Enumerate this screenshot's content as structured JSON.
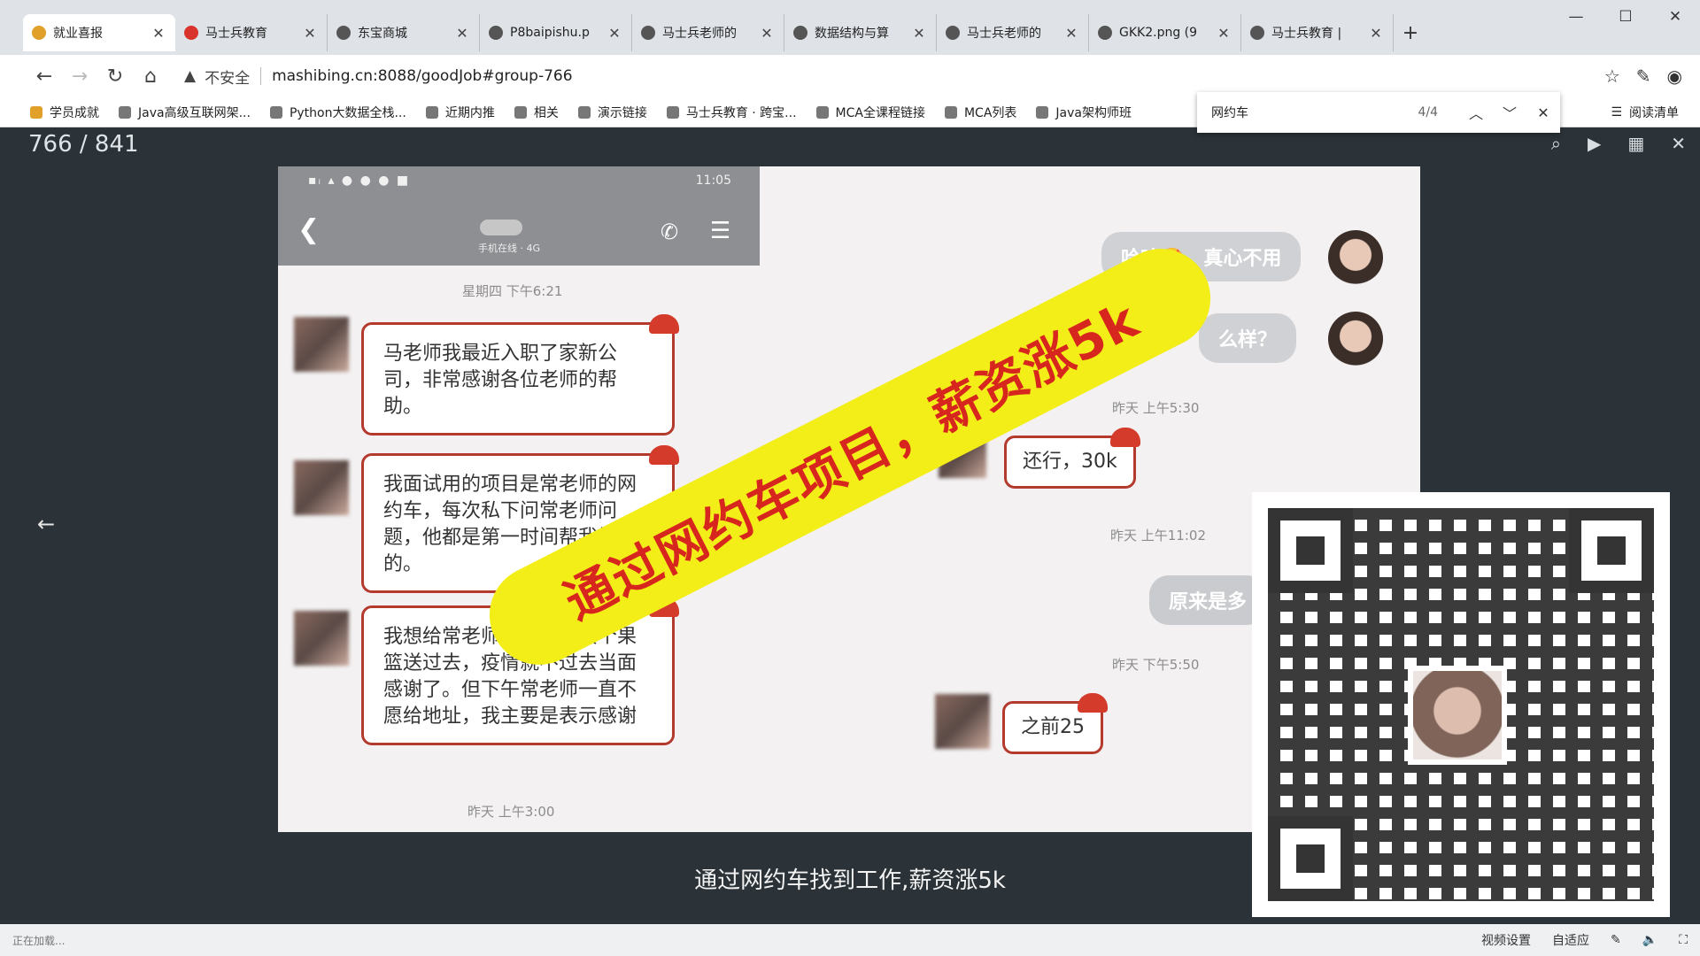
{
  "tabs": [
    {
      "label": "就业喜报",
      "color": "#e0a02a"
    },
    {
      "label": "马士兵教育",
      "color": "#d9342b"
    },
    {
      "label": "东宝商城",
      "color": "#555555"
    },
    {
      "label": "P8baipishu.p",
      "color": "#555555"
    },
    {
      "label": "马士兵老师的",
      "color": "#555555"
    },
    {
      "label": "数据结构与算",
      "color": "#555555"
    },
    {
      "label": "马士兵老师的",
      "color": "#555555"
    },
    {
      "label": "GKK2.png (9",
      "color": "#555555"
    },
    {
      "label": "马士兵教育 |",
      "color": "#555555"
    }
  ],
  "address": {
    "insecure_label": "不安全",
    "url": "mashibing.cn:8088/goodJob#group-766"
  },
  "bookmarks": [
    "学员成就",
    "Java高级互联网架...",
    "Python大数据全栈...",
    "近期内推",
    "相关",
    "演示链接",
    "马士兵教育 · 跨宝...",
    "MCA全课程链接",
    "MCA列表",
    "Java架构师班"
  ],
  "reading_list": "阅读清单",
  "find": {
    "query": "网约车",
    "count": "4/4"
  },
  "viewer": {
    "page": "766 / 841"
  },
  "phone": {
    "status_time": "11:05",
    "contact_sub": "手机在线 · 4G"
  },
  "chat": {
    "ts1": "星期四 下午6:21",
    "left_msgs": [
      "马老师我最近入职了家新公司，非常感谢各位老师的帮助。",
      "我面试用的项目是常老师的网约车，每次私下问常老师问题，他都是第一时间帮我解决的。",
      "我想给常老师和马老师买个果篮送过去，疫情就不过去当面感谢了。但下午常老师一直不愿给地址，我主要是表示感谢"
    ],
    "ts_bottom": "昨天 上午3:00",
    "right_top_1": "哈哈🤩，真心不用",
    "right_top_2": "么样？",
    "ts_r1": "昨天 上午5:30",
    "reply_1": "还行，30k",
    "ts_r2": "昨天 上午11:02",
    "right_mid": "原来是多",
    "ts_r3": "昨天 下午5:50",
    "reply_2": "之前25"
  },
  "banner": "通过网约车项目，薪资涨5k",
  "caption": "通过网约车找到工作,薪资涨5k",
  "status": {
    "left": "正在加载...",
    "video_settings": "视频设置",
    "subtitle": "自适应"
  }
}
